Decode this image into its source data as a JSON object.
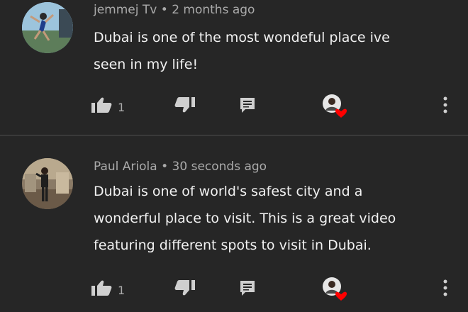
{
  "comments": [
    {
      "author": "jemmej Tv",
      "separator": "•",
      "time": "2 months ago",
      "lines": [
        "Dubai is one of the most wondeful place ive",
        "seen in my life!"
      ],
      "likes": "1",
      "avatar_icon": "person-jumping-photo",
      "hearted": true
    },
    {
      "author": "Paul Ariola",
      "separator": "•",
      "time": "30 seconds ago",
      "lines": [
        "Dubai is one of world's safest city and a",
        "wonderful place to visit. This is a great video",
        "featuring different spots to visit in Dubai."
      ],
      "likes": "1",
      "avatar_icon": "person-standing-photo",
      "hearted": true
    }
  ],
  "icons": {
    "like": "thumb-up-icon",
    "dislike": "thumb-down-icon",
    "reply": "reply-comment-icon",
    "heart": "creator-heart-icon",
    "more": "more-vertical-icon"
  },
  "colors": {
    "background": "#262626",
    "text": "#f1f1f1",
    "meta": "#aaaaaa",
    "heart": "#ff0000",
    "icon": "#cfcfcf"
  }
}
